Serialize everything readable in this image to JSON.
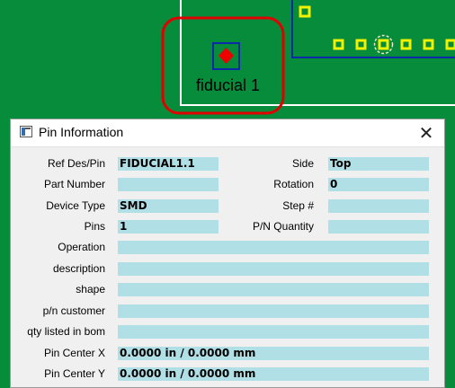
{
  "board": {
    "fiducial_label": "fiducial 1",
    "colors": {
      "board": "#078c3c",
      "highlight": "#e10000",
      "pad": "#f2f200",
      "marker": "#ee0000",
      "outline": "#0a2aa8"
    }
  },
  "dialog": {
    "title": "Pin Information",
    "close_label": "✕",
    "icon": "window-app-icon",
    "fields": [
      {
        "label": "Ref Des/Pin",
        "value": "FIDUCIAL1.1"
      },
      {
        "label": "Part Number",
        "value": ""
      },
      {
        "label": "Device Type",
        "value": "SMD"
      },
      {
        "label": "Pins",
        "value": "1"
      },
      {
        "label": "Operation",
        "value": ""
      },
      {
        "label": "description",
        "value": ""
      },
      {
        "label": "shape",
        "value": ""
      },
      {
        "label": "p/n customer",
        "value": ""
      },
      {
        "label": "qty listed in bom",
        "value": ""
      },
      {
        "label": "Pin Center X",
        "value": "0.0000 in / 0.0000 mm"
      },
      {
        "label": "Pin Center Y",
        "value": "0.0000 in / 0.0000 mm"
      }
    ],
    "right_fields": [
      {
        "label": "Side",
        "value": "Top"
      },
      {
        "label": "Rotation",
        "value": "0"
      },
      {
        "label": "Step #",
        "value": ""
      },
      {
        "label": "P/N Quantity",
        "value": ""
      }
    ]
  }
}
